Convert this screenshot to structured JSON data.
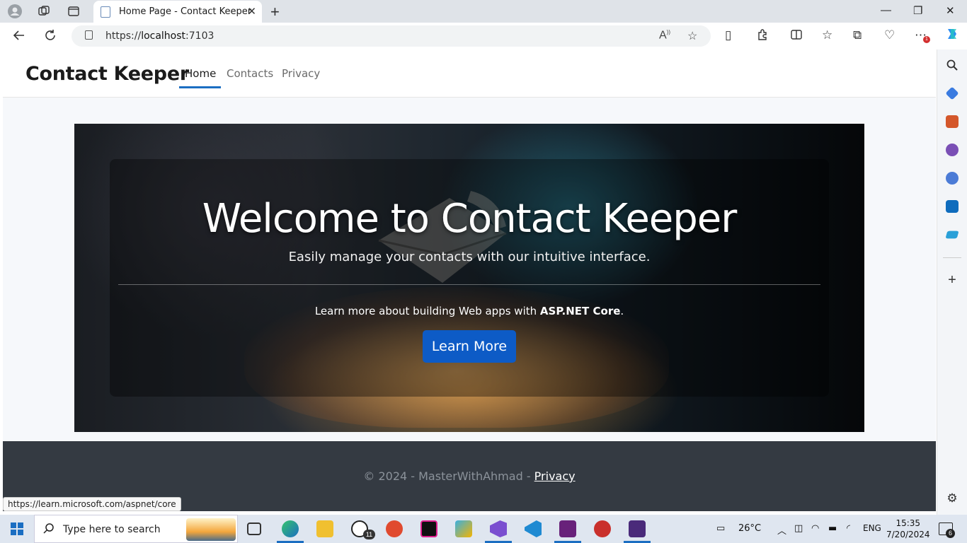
{
  "browser": {
    "tab_title": "Home Page - Contact Keeper",
    "url_prefix": "https://",
    "url_host": "localhost",
    "url_port": ":7103",
    "status_link": "https://learn.microsoft.com/aspnet/core",
    "notification_count": "1"
  },
  "site": {
    "brand": "Contact Keeper",
    "nav": [
      {
        "label": "Home",
        "active": true
      },
      {
        "label": "Contacts",
        "active": false
      },
      {
        "label": "Privacy",
        "active": false
      }
    ]
  },
  "hero": {
    "title": "Welcome to Contact Keeper",
    "subtitle": "Easily manage your contacts with our intuitive interface.",
    "learn_prefix": "Learn more about building Web apps with ",
    "learn_bold": "ASP.NET Core",
    "learn_suffix": ".",
    "button": "Learn More"
  },
  "footer": {
    "text": "© 2024 - MasterWithAhmad - ",
    "link": "Privacy"
  },
  "taskbar": {
    "search_placeholder": "Type here to search",
    "whatsapp_badge": "11",
    "weather": "26°C",
    "language": "ENG",
    "time": "15:35",
    "date": "7/20/2024",
    "notifications": "6"
  },
  "colors": {
    "accent": "#1b6ec2",
    "button": "#0d5bc6",
    "footer_bg": "#343a42"
  }
}
